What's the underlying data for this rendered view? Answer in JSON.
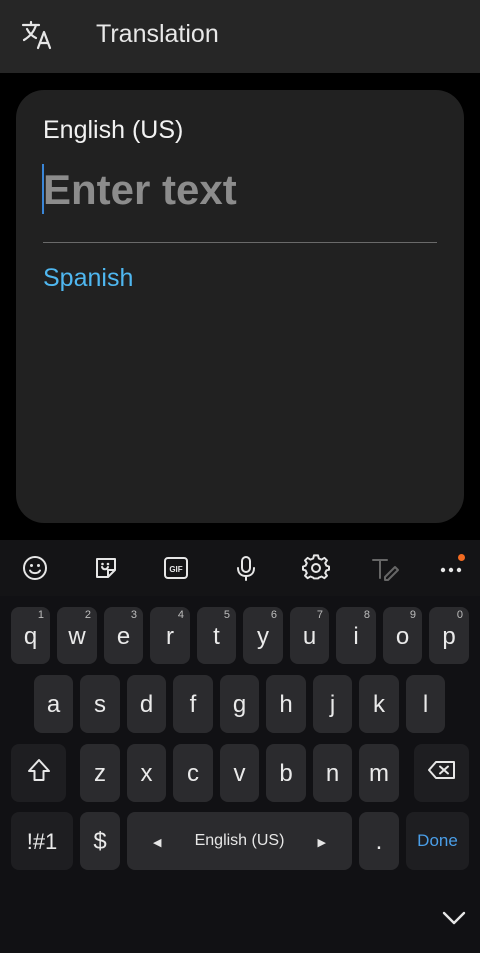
{
  "header": {
    "title": "Translation",
    "icon": "translate-icon"
  },
  "card": {
    "source_language": "English (US)",
    "input_placeholder": "Enter text",
    "input_value": "",
    "target_language": "Spanish"
  },
  "keyboard": {
    "toolbar": [
      "emoji-icon",
      "sticker-icon",
      "gif-icon",
      "microphone-icon",
      "settings-icon",
      "handwriting-icon",
      "more-icon"
    ],
    "gif_label": "GIF",
    "row1": [
      {
        "ch": "q",
        "num": "1"
      },
      {
        "ch": "w",
        "num": "2"
      },
      {
        "ch": "e",
        "num": "3"
      },
      {
        "ch": "r",
        "num": "4"
      },
      {
        "ch": "t",
        "num": "5"
      },
      {
        "ch": "y",
        "num": "6"
      },
      {
        "ch": "u",
        "num": "7"
      },
      {
        "ch": "i",
        "num": "8"
      },
      {
        "ch": "o",
        "num": "9"
      },
      {
        "ch": "p",
        "num": "0"
      }
    ],
    "row2": [
      "a",
      "s",
      "d",
      "f",
      "g",
      "h",
      "j",
      "k",
      "l"
    ],
    "row3": [
      "z",
      "x",
      "c",
      "v",
      "b",
      "n",
      "m"
    ],
    "symbols_label": "!#1",
    "currency_label": "$",
    "space_label": "English (US)",
    "period_label": ".",
    "done_label": "Done"
  },
  "colors": {
    "accent_blue": "#4fb7f0",
    "done_blue": "#4a9ee8",
    "notification_orange": "#f26b21"
  }
}
